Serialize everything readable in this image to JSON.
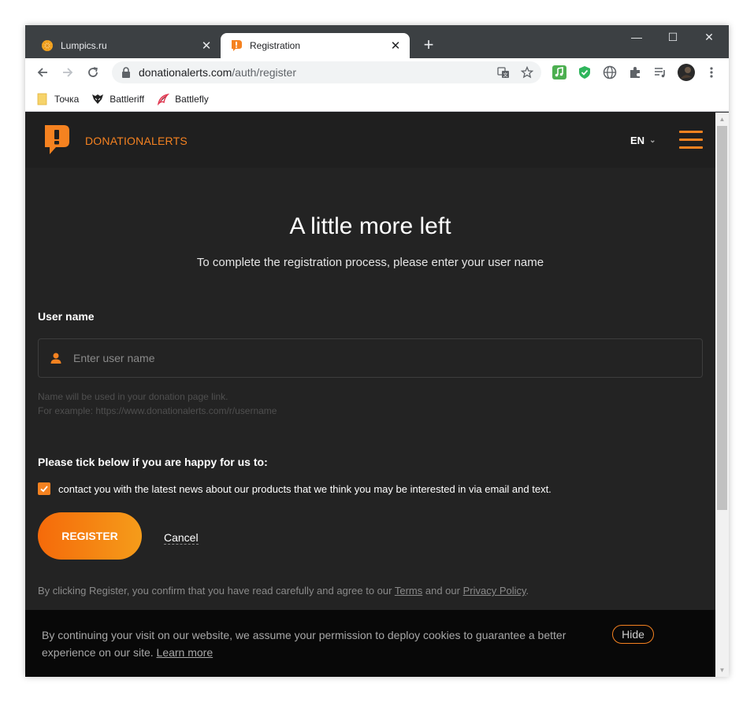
{
  "browser": {
    "tabs": [
      {
        "title": "Lumpics.ru",
        "active": false,
        "close": "✕"
      },
      {
        "title": "Registration",
        "active": true,
        "close": "✕"
      }
    ],
    "new_tab": "+",
    "window_controls": {
      "minimize": "—",
      "maximize": "☐",
      "close": "✕"
    },
    "nav": {
      "back": "back-arrow-icon",
      "forward": "forward-arrow-icon",
      "reload": "reload-icon"
    },
    "address": {
      "domain": "donationalerts.com",
      "path": "/auth/register"
    },
    "bookmarks": [
      {
        "label": "Точка",
        "icon": "folder-icon"
      },
      {
        "label": "Battleriff",
        "icon": "battleriff-icon"
      },
      {
        "label": "Battlefly",
        "icon": "battlefly-icon"
      }
    ]
  },
  "site": {
    "brand": "DONATIONALERTS",
    "language": "EN",
    "accent_color": "#f58220"
  },
  "form": {
    "title": "A little more left",
    "subtitle": "To complete the registration process, please enter your user name",
    "username_label": "User name",
    "username_placeholder": "Enter user name",
    "username_value": "",
    "hint_line1": "Name will be used in your donation page link.",
    "hint_line2": "For example: https://www.donationalerts.com/r/username",
    "consent_title": "Please tick below if you are happy for us to:",
    "consent_text": "contact you with the latest news about our products that we think you may be interested in via email and text.",
    "consent_checked": true,
    "register_label": "REGISTER",
    "cancel_label": "Cancel",
    "terms_prefix": "By clicking Register, you confirm that you have read carefully and agree to our",
    "terms_link": "Terms",
    "terms_and": "and our",
    "privacy_link": "Privacy Policy",
    "terms_suffix": "."
  },
  "cookie_banner": {
    "text": "By continuing your visit on our website, we assume your permission to deploy cookies to guarantee a better experience on our site.",
    "learn_more": "Learn more",
    "hide_label": "Hide"
  }
}
